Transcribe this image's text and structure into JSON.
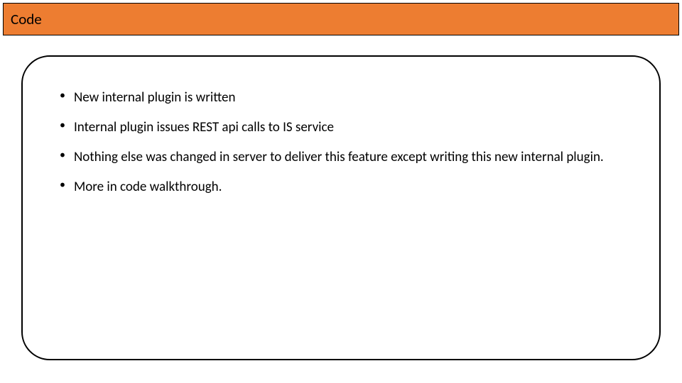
{
  "title": "Code",
  "bullets": [
    "New internal plugin is written",
    "Internal plugin issues REST api calls to IS service",
    "Nothing else was changed in server to deliver this feature except writing this new internal plugin.",
    "More in code walkthrough."
  ]
}
